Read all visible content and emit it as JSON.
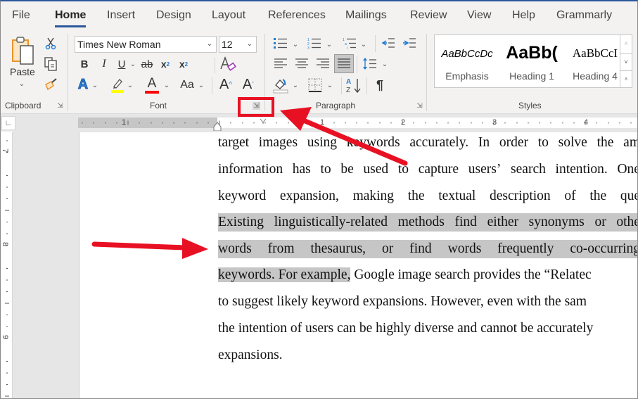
{
  "tabs": [
    "File",
    "Home",
    "Insert",
    "Design",
    "Layout",
    "References",
    "Mailings",
    "Review",
    "View",
    "Help",
    "Grammarly"
  ],
  "active_tab": "Home",
  "clipboard": {
    "paste_label": "Paste",
    "group_label": "Clipboard",
    "icons": [
      "paste-icon",
      "cut-icon",
      "copy-icon",
      "format-painter-icon"
    ]
  },
  "font": {
    "font_name": "Times New Roman",
    "font_size": "12",
    "group_label": "Font",
    "bold": "B",
    "italic": "I",
    "underline": "U",
    "strike": "ab",
    "subscript": "x",
    "superscript": "x",
    "text_effects": "A",
    "highlight_color": "#ffff00",
    "font_color_letter": "A",
    "font_color": "#ff0000",
    "change_case": "Aa",
    "grow": "A",
    "shrink": "A"
  },
  "paragraph": {
    "group_label": "Paragraph",
    "pilcrow": "¶",
    "active_alignment": "justify"
  },
  "styles": {
    "group_label": "Styles",
    "items": [
      {
        "sample": "AaBbCcDc",
        "name": "Emphasis"
      },
      {
        "sample": "AaBb(",
        "name": "Heading 1"
      },
      {
        "sample": "AaBbCcI",
        "name": "Heading 4"
      }
    ]
  },
  "ruler": {
    "h_numbers": [
      "1",
      "1",
      "2",
      "3",
      "4"
    ],
    "v_numbers": [
      "7",
      "8",
      "9"
    ]
  },
  "document": {
    "lines": [
      {
        "text": "target images using keywords accurately. In order to solve the am",
        "justify": true,
        "selected": false
      },
      {
        "text": "information has to be used to capture users’ search intention. One",
        "justify": true,
        "selected": false
      },
      {
        "text": "keyword expansion, making the textual description of the que",
        "justify": true,
        "selected": false
      },
      {
        "text": "Existing linguistically-related methods find either synonyms or othe",
        "justify": true,
        "selected": true
      },
      {
        "text": "words from thesaurus, or find words frequently co-occurring",
        "justify": true,
        "selected": true
      },
      {
        "selected_part": "keywords. For example,",
        "rest": " Google image search provides the “Relatec"
      },
      {
        "text": "to suggest likely keyword expansions. However, even with the sam",
        "justify": false,
        "selected": false
      },
      {
        "text": "the intention of users can be highly diverse and cannot be accurately",
        "justify": false,
        "selected": false
      },
      {
        "text": "expansions.",
        "justify": false,
        "selected": false
      }
    ]
  },
  "annotation": {
    "color": "#e81123",
    "target": "paragraph-dialog-launcher"
  }
}
